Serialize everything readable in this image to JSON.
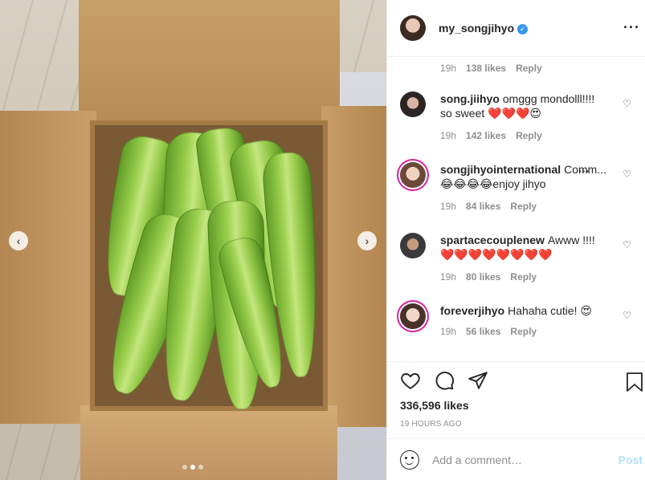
{
  "header": {
    "username": "my_songjihyo",
    "verified_icon": "verified-badge-icon",
    "more_icon": "more-icon"
  },
  "top_meta": {
    "time": "19h",
    "likes": "138 likes",
    "reply": "Reply"
  },
  "comments": [
    {
      "user": "song.jiihyo",
      "text": "omggg mondolll!!!! so sweet ❤️❤️❤️😍",
      "time": "19h",
      "likes": "142 likes",
      "reply": "Reply"
    },
    {
      "user": "songjihyointernational",
      "text": "Comm... 😂😂😂😂enjoy jihyo",
      "time": "19h",
      "likes": "84 likes",
      "reply": "Reply"
    },
    {
      "user": "spartacecouplenew",
      "text": "Awww !!!! ❤️❤️❤️❤️❤️❤️❤️❤️",
      "time": "19h",
      "likes": "80 likes",
      "reply": "Reply"
    },
    {
      "user": "foreverjihyo",
      "text": "Hahaha cutie! 😍",
      "time": "19h",
      "likes": "56 likes",
      "reply": "Reply"
    }
  ],
  "actions": {
    "likes": "336,596 likes",
    "time_ago": "19 HOURS AGO"
  },
  "add_comment": {
    "placeholder": "Add a comment…",
    "post_label": "Post"
  },
  "media": {
    "prev_glyph": "‹",
    "next_glyph": "›",
    "carousel_total": 3,
    "carousel_active": 2
  },
  "colors": {
    "accent_link": "#b2dffc",
    "verified": "#3897f0",
    "muted": "#8e8e8e"
  }
}
